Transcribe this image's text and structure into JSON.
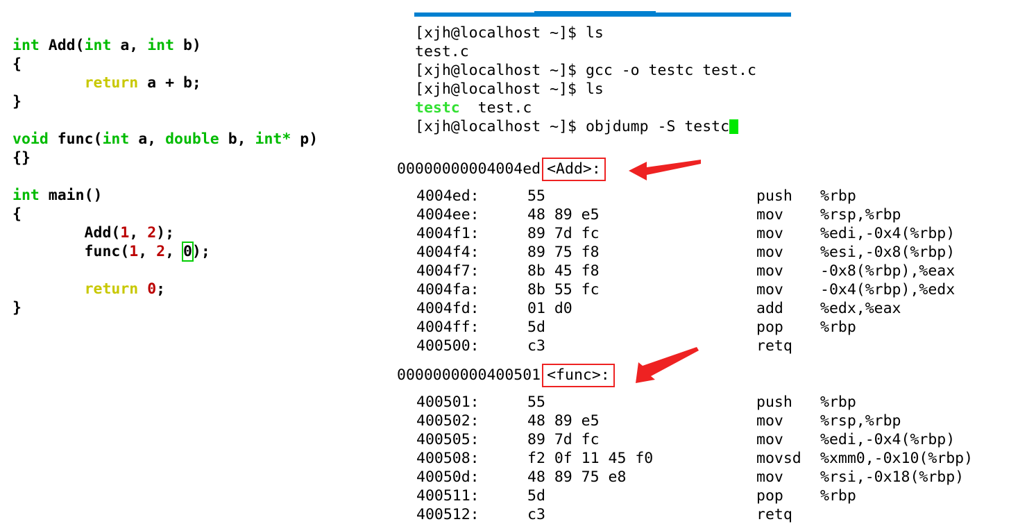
{
  "editor": {
    "lines": [
      [
        {
          "t": "int",
          "c": "kw"
        },
        {
          "t": " Add(",
          "c": "plain"
        },
        {
          "t": "int",
          "c": "kw"
        },
        {
          "t": " a, ",
          "c": "plain"
        },
        {
          "t": "int",
          "c": "kw"
        },
        {
          "t": " b)",
          "c": "plain"
        }
      ],
      [
        {
          "t": "{",
          "c": "plain"
        }
      ],
      [
        {
          "t": "        ",
          "c": "plain"
        },
        {
          "t": "return",
          "c": "kwret"
        },
        {
          "t": " a + b;",
          "c": "plain"
        }
      ],
      [
        {
          "t": "}",
          "c": "plain"
        }
      ],
      [],
      [
        {
          "t": "void",
          "c": "kw"
        },
        {
          "t": " func(",
          "c": "plain"
        },
        {
          "t": "int",
          "c": "kw"
        },
        {
          "t": " a, ",
          "c": "plain"
        },
        {
          "t": "double",
          "c": "kw"
        },
        {
          "t": " b, ",
          "c": "plain"
        },
        {
          "t": "int*",
          "c": "kw"
        },
        {
          "t": " p)",
          "c": "plain"
        }
      ],
      [
        {
          "t": "{}",
          "c": "plain"
        }
      ],
      [],
      [
        {
          "t": "int",
          "c": "kw"
        },
        {
          "t": " main()",
          "c": "plain"
        }
      ],
      [
        {
          "t": "{",
          "c": "plain"
        }
      ],
      [
        {
          "t": "        Add(",
          "c": "plain"
        },
        {
          "t": "1",
          "c": "num"
        },
        {
          "t": ", ",
          "c": "plain"
        },
        {
          "t": "2",
          "c": "num"
        },
        {
          "t": ");",
          "c": "plain"
        }
      ],
      [
        {
          "t": "        func(",
          "c": "plain"
        },
        {
          "t": "1",
          "c": "num"
        },
        {
          "t": ", ",
          "c": "plain"
        },
        {
          "t": "2",
          "c": "num"
        },
        {
          "t": ", ",
          "c": "plain"
        },
        {
          "t": "0",
          "c": "boxnum"
        },
        {
          "t": ");",
          "c": "plain"
        }
      ],
      [],
      [
        {
          "t": "        ",
          "c": "plain"
        },
        {
          "t": "return",
          "c": "kwret"
        },
        {
          "t": " ",
          "c": "plain"
        },
        {
          "t": "0",
          "c": "num"
        },
        {
          "t": ";",
          "c": "plain"
        }
      ],
      [
        {
          "t": "}",
          "c": "plain"
        }
      ]
    ]
  },
  "terminal": {
    "prompt": "[xjh@localhost ~]$ ",
    "lines": [
      {
        "kind": "command",
        "prompt": "[xjh@localhost ~]$ ",
        "command": "ls"
      },
      {
        "kind": "output",
        "text": "test.c"
      },
      {
        "kind": "command",
        "prompt": "[xjh@localhost ~]$ ",
        "command": "gcc -o testc test.c"
      },
      {
        "kind": "command",
        "prompt": "[xjh@localhost ~]$ ",
        "command": "ls"
      },
      {
        "kind": "ls-output",
        "exe": "testc",
        "rest": "  test.c"
      },
      {
        "kind": "command-cursor",
        "prompt": "[xjh@localhost ~]$ ",
        "command": "objdump -S testc"
      }
    ]
  },
  "disassembly": {
    "blocks": [
      {
        "address": "00000000004004ed",
        "symbol": "<Add>:",
        "rows": [
          {
            "addr": "4004ed:",
            "bytes": "55",
            "mnemonic": "push",
            "operands": "%rbp"
          },
          {
            "addr": "4004ee:",
            "bytes": "48 89 e5",
            "mnemonic": "mov",
            "operands": "%rsp,%rbp"
          },
          {
            "addr": "4004f1:",
            "bytes": "89 7d fc",
            "mnemonic": "mov",
            "operands": "%edi,-0x4(%rbp)"
          },
          {
            "addr": "4004f4:",
            "bytes": "89 75 f8",
            "mnemonic": "mov",
            "operands": "%esi,-0x8(%rbp)"
          },
          {
            "addr": "4004f7:",
            "bytes": "8b 45 f8",
            "mnemonic": "mov",
            "operands": "-0x8(%rbp),%eax"
          },
          {
            "addr": "4004fa:",
            "bytes": "8b 55 fc",
            "mnemonic": "mov",
            "operands": "-0x4(%rbp),%edx"
          },
          {
            "addr": "4004fd:",
            "bytes": "01 d0",
            "mnemonic": "add",
            "operands": "%edx,%eax"
          },
          {
            "addr": "4004ff:",
            "bytes": "5d",
            "mnemonic": "pop",
            "operands": "%rbp"
          },
          {
            "addr": "400500:",
            "bytes": "c3",
            "mnemonic": "retq",
            "operands": ""
          }
        ]
      },
      {
        "address": "0000000000400501",
        "symbol": "<func>:",
        "rows": [
          {
            "addr": "400501:",
            "bytes": "55",
            "mnemonic": "push",
            "operands": "%rbp"
          },
          {
            "addr": "400502:",
            "bytes": "48 89 e5",
            "mnemonic": "mov",
            "operands": "%rsp,%rbp"
          },
          {
            "addr": "400505:",
            "bytes": "89 7d fc",
            "mnemonic": "mov",
            "operands": "%edi,-0x4(%rbp)"
          },
          {
            "addr": "400508:",
            "bytes": "f2 0f 11 45 f0",
            "mnemonic": "movsd",
            "operands": "%xmm0,-0x10(%rbp)"
          },
          {
            "addr": "40050d:",
            "bytes": "48 89 75 e8",
            "mnemonic": "mov",
            "operands": "%rsi,-0x18(%rbp)"
          },
          {
            "addr": "400511:",
            "bytes": "5d",
            "mnemonic": "pop",
            "operands": "%rbp"
          },
          {
            "addr": "400512:",
            "bytes": "c3",
            "mnemonic": "retq",
            "operands": ""
          }
        ]
      }
    ]
  },
  "annotations": {
    "arrows": [
      {
        "name": "arrow-to-add-symbol",
        "direction": "left"
      },
      {
        "name": "arrow-to-func-symbol",
        "direction": "down-left"
      }
    ],
    "highlight_boxes": [
      {
        "name": "add-symbol-box",
        "color": "#ee2222"
      },
      {
        "name": "func-symbol-box",
        "color": "#ee2222"
      },
      {
        "name": "zero-arg-box",
        "color": "#00cc00"
      }
    ]
  },
  "colors": {
    "keyword_type": "#00bb00",
    "keyword_return": "#c8c800",
    "number_literal": "#bb0000",
    "executable_green": "#33e033",
    "cursor_green": "#00e800",
    "annotation_red": "#ee2222",
    "titlebar_blue": "#0080d0",
    "text": "#000000",
    "background": "#ffffff"
  }
}
